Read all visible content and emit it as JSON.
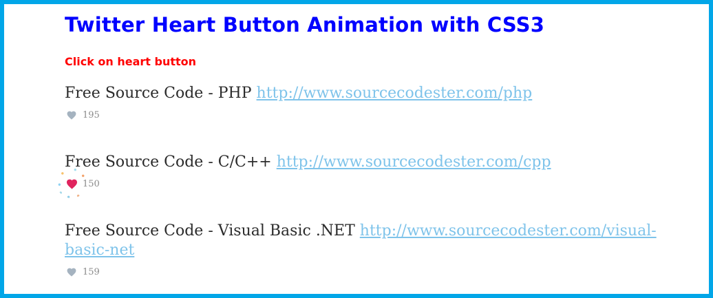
{
  "page": {
    "title": "Twitter Heart Button Animation with CSS3",
    "instruction": "Click on heart button"
  },
  "colors": {
    "frame_border": "#01a6e8",
    "title": "#0000ff",
    "instruction": "#ff0000",
    "link": "#7ec3ea",
    "heart_inactive": "#a5b3c0",
    "heart_active": "#e0245e"
  },
  "items": [
    {
      "text": "Free Source Code - PHP",
      "link": "http://www.sourcecodester.com/php",
      "likes": "195",
      "heart_state": "inactive",
      "heart_icon": "heart-icon"
    },
    {
      "text": "Free Source Code - C/C++",
      "link": "http://www.sourcecodester.com/cpp",
      "likes": "150",
      "heart_state": "active",
      "heart_icon": "heart-icon"
    },
    {
      "text": "Free Source Code - Visual Basic .NET",
      "link": "http://www.sourcecodester.com/visual-basic-net",
      "likes": "159",
      "heart_state": "inactive",
      "heart_icon": "heart-icon"
    }
  ]
}
